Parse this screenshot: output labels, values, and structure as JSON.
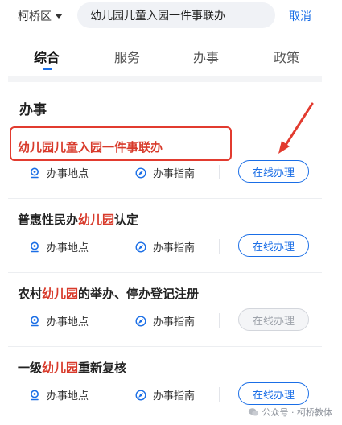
{
  "header": {
    "region": "柯桥区",
    "search_value": "幼儿园儿童入园一件事联办",
    "cancel_label": "取消"
  },
  "tabs": [
    {
      "label": "综合",
      "active": true
    },
    {
      "label": "服务",
      "active": false
    },
    {
      "label": "办事",
      "active": false
    },
    {
      "label": "政策",
      "active": false
    }
  ],
  "section": {
    "title": "办事"
  },
  "items": [
    {
      "title_parts": [
        {
          "text": "幼儿园儿童入园一件事联办",
          "highlight": true
        }
      ],
      "location_label": "办事地点",
      "guide_label": "办事指南",
      "action_label": "在线办理",
      "action_enabled": true
    },
    {
      "title_parts": [
        {
          "text": "普惠性民办",
          "highlight": false
        },
        {
          "text": "幼儿园",
          "highlight": true
        },
        {
          "text": "认定",
          "highlight": false
        }
      ],
      "location_label": "办事地点",
      "guide_label": "办事指南",
      "action_label": "在线办理",
      "action_enabled": true
    },
    {
      "title_parts": [
        {
          "text": "农村",
          "highlight": false
        },
        {
          "text": "幼儿园",
          "highlight": true
        },
        {
          "text": "的举办、停办登记注册",
          "highlight": false
        }
      ],
      "location_label": "办事地点",
      "guide_label": "办事指南",
      "action_label": "在线办理",
      "action_enabled": false
    },
    {
      "title_parts": [
        {
          "text": "一级",
          "highlight": false
        },
        {
          "text": "幼儿园",
          "highlight": true
        },
        {
          "text": "重新复核",
          "highlight": false
        }
      ],
      "location_label": "办事地点",
      "guide_label": "办事指南",
      "action_label": "在线办理",
      "action_enabled": true
    }
  ],
  "watermark": {
    "text": "公众号 · 柯桥教体"
  },
  "colors": {
    "accent": "#1a6ee6",
    "highlight": "#d83a2b",
    "annotation": "#e23b2f"
  }
}
